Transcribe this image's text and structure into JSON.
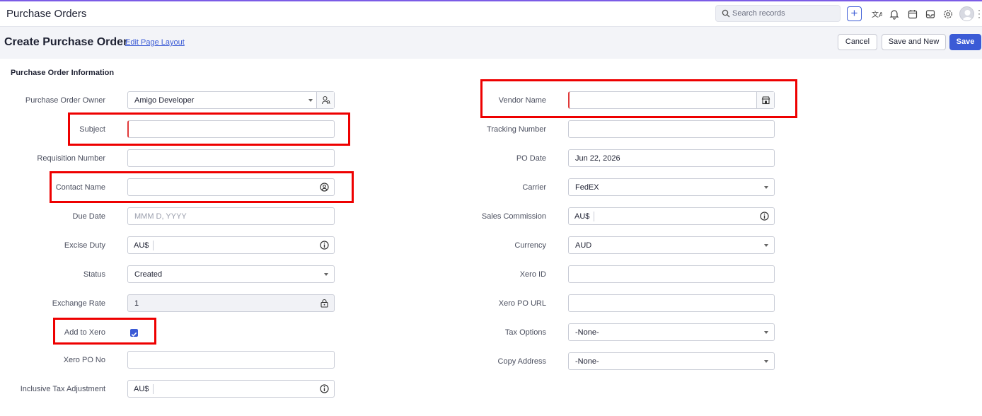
{
  "topbar": {
    "title": "Purchase Orders",
    "search_placeholder": "Search records",
    "icons": [
      "search-icon",
      "plus-icon",
      "translate-icon",
      "bell-icon",
      "calendar-icon",
      "inbox-icon",
      "gear-icon",
      "avatar",
      "kebab-icon"
    ]
  },
  "header": {
    "title": "Create Purchase Order",
    "edit_link": "Edit Page Layout",
    "cancel_label": "Cancel",
    "save_new_label": "Save and New",
    "save_label": "Save"
  },
  "section": {
    "title": "Purchase Order Information"
  },
  "left": {
    "owner": {
      "label": "Purchase Order Owner",
      "value": "Amigo Developer"
    },
    "subject": {
      "label": "Subject",
      "value": ""
    },
    "requisition": {
      "label": "Requisition Number",
      "value": ""
    },
    "contact": {
      "label": "Contact Name",
      "value": ""
    },
    "due_date": {
      "label": "Due Date",
      "placeholder": "MMM D, YYYY"
    },
    "excise": {
      "label": "Excise Duty",
      "prefix": "AU$"
    },
    "status": {
      "label": "Status",
      "value": "Created"
    },
    "exchange": {
      "label": "Exchange Rate",
      "value": "1"
    },
    "xero": {
      "label": "Add to Xero",
      "checked": true
    },
    "xero_po_no": {
      "label": "Xero PO No",
      "value": ""
    },
    "tax_adj": {
      "label": "Inclusive Tax Adjustment",
      "prefix": "AU$"
    }
  },
  "right": {
    "vendor": {
      "label": "Vendor Name",
      "value": ""
    },
    "tracking": {
      "label": "Tracking Number",
      "value": ""
    },
    "po_date": {
      "label": "PO Date",
      "value": "Jun 22, 2026"
    },
    "carrier": {
      "label": "Carrier",
      "value": "FedEX"
    },
    "commission": {
      "label": "Sales Commission",
      "prefix": "AU$"
    },
    "currency": {
      "label": "Currency",
      "value": "AUD"
    },
    "xero_id": {
      "label": "Xero ID",
      "value": ""
    },
    "xero_url": {
      "label": "Xero PO URL",
      "value": ""
    },
    "tax_options": {
      "label": "Tax Options",
      "value": "-None-"
    },
    "copy_address": {
      "label": "Copy Address",
      "value": "-None-"
    }
  },
  "colors": {
    "accent": "#3b5bd6",
    "required": "#e03a3a",
    "highlight": "#ee0000"
  }
}
